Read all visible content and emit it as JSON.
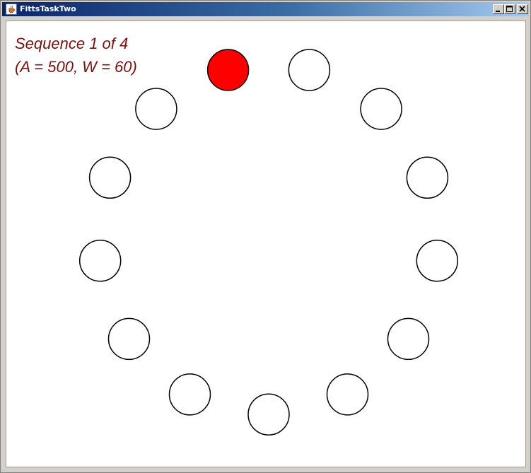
{
  "window": {
    "title": "FittsTaskTwo",
    "app_icon": "java-cup-icon",
    "controls": [
      "minimize-icon",
      "maximize-icon",
      "close-icon"
    ]
  },
  "status": {
    "line1": "Sequence 1 of 4",
    "line2": "(A = 500, W = 60)"
  },
  "task": {
    "target_count": 13,
    "highlighted_index": 0,
    "colors": {
      "highlight_fill": "#ff0000",
      "target_fill": "#ffffff",
      "outline": "#000000",
      "text": "#7a1010"
    }
  }
}
